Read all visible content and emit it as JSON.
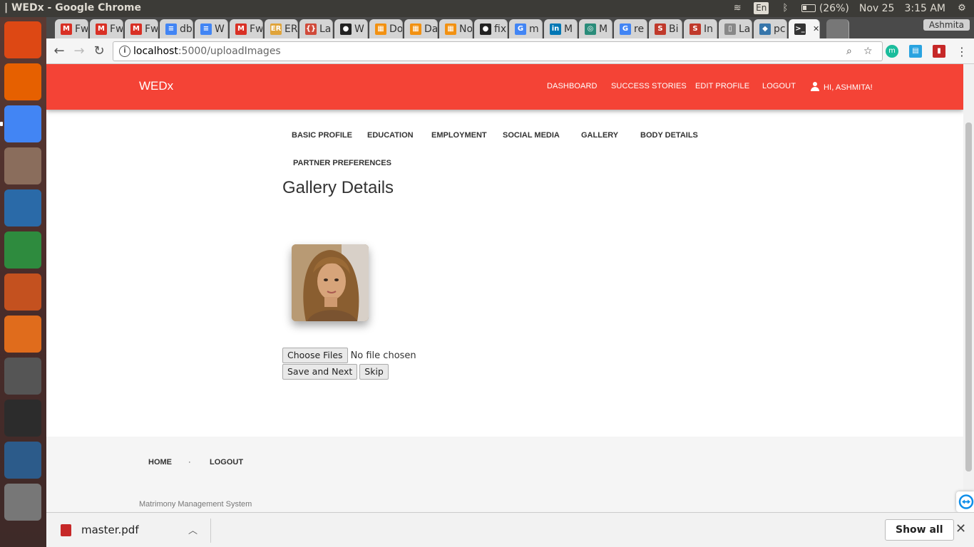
{
  "window": {
    "title": "| WEDx - Google Chrome"
  },
  "panel": {
    "lang": "En",
    "battery": "(26%)",
    "date": "Nov 25",
    "time": "3:15 AM"
  },
  "launcher": [
    {
      "name": "ubuntu",
      "icon": "ubuntu-dash-icon",
      "color": "#dd4814"
    },
    {
      "name": "firefox",
      "icon": "firefox-icon",
      "color": "#e66000"
    },
    {
      "name": "chrome",
      "icon": "chrome-icon",
      "color": "#4285f4"
    },
    {
      "name": "files",
      "icon": "files-icon",
      "color": "#8a6d5c"
    },
    {
      "name": "writer",
      "icon": "writer-icon",
      "color": "#2a6aa8"
    },
    {
      "name": "calc",
      "icon": "calc-icon",
      "color": "#2e8b3e"
    },
    {
      "name": "impress",
      "icon": "impress-icon",
      "color": "#c4511f"
    },
    {
      "name": "software",
      "icon": "software-center-icon",
      "color": "#e06c1c"
    },
    {
      "name": "sublime",
      "icon": "sublime-icon",
      "color": "#555"
    },
    {
      "name": "terminal",
      "icon": "terminal-icon",
      "color": "#2c2c2c"
    },
    {
      "name": "mysql-workbench",
      "icon": "mysql-workbench-icon",
      "color": "#2c5b8a"
    },
    {
      "name": "texmaker",
      "icon": "texmaker-icon",
      "color": "#777"
    }
  ],
  "tabs": [
    {
      "label": "Fw",
      "fav": "M",
      "color": "#d93025"
    },
    {
      "label": "Fw",
      "fav": "M",
      "color": "#d93025"
    },
    {
      "label": "Fw",
      "fav": "M",
      "color": "#d93025"
    },
    {
      "label": "db",
      "fav": "≡",
      "color": "#4285f4"
    },
    {
      "label": "W",
      "fav": "≡",
      "color": "#4285f4"
    },
    {
      "label": "Fw",
      "fav": "M",
      "color": "#d93025"
    },
    {
      "label": "ER",
      "fav": "ER",
      "color": "#e0a43a"
    },
    {
      "label": "La",
      "fav": "{}",
      "color": "#d04a3a"
    },
    {
      "label": "W",
      "fav": "●",
      "color": "#222"
    },
    {
      "label": "Do",
      "fav": "▦",
      "color": "#f29111"
    },
    {
      "label": "Da",
      "fav": "▦",
      "color": "#f29111"
    },
    {
      "label": "No",
      "fav": "▦",
      "color": "#f29111"
    },
    {
      "label": "fix",
      "fav": "●",
      "color": "#222"
    },
    {
      "label": "m",
      "fav": "G",
      "color": "#4285f4"
    },
    {
      "label": "M",
      "fav": "in",
      "color": "#0077b5"
    },
    {
      "label": "M",
      "fav": "◎",
      "color": "#2a8c7a"
    },
    {
      "label": "re",
      "fav": "G",
      "color": "#4285f4"
    },
    {
      "label": "Bi",
      "fav": "S",
      "color": "#c0392b"
    },
    {
      "label": "In",
      "fav": "S",
      "color": "#c0392b"
    },
    {
      "label": "La",
      "fav": "▯",
      "color": "#888"
    },
    {
      "label": "pc",
      "fav": "◆",
      "color": "#3776ab"
    },
    {
      "label": "",
      "fav": ">_",
      "color": "#333",
      "active": true
    }
  ],
  "profile_name": "Ashmita",
  "address": {
    "host": "localhost",
    "path": ":5000/uploadImages"
  },
  "site": {
    "brand": "WEDx",
    "nav": [
      "DASHBOARD",
      "SUCCESS STORIES",
      "EDIT PROFILE",
      "LOGOUT"
    ],
    "greeting": "HI, ASHMITA!",
    "subnav": [
      "BASIC PROFILE",
      "EDUCATION",
      "EMPLOYMENT",
      "SOCIAL MEDIA",
      "GALLERY",
      "BODY DETAILS",
      "PARTNER PREFERENCES"
    ],
    "heading": "Gallery Details",
    "file_button": "Choose Files",
    "file_status": "No file chosen",
    "save_button": "Save and Next",
    "skip_button": "Skip",
    "footer_links": [
      "HOME",
      "·",
      "LOGOUT"
    ],
    "footer_note": "Matrimony Management System"
  },
  "download": {
    "file": "master.pdf",
    "show_all": "Show all"
  }
}
